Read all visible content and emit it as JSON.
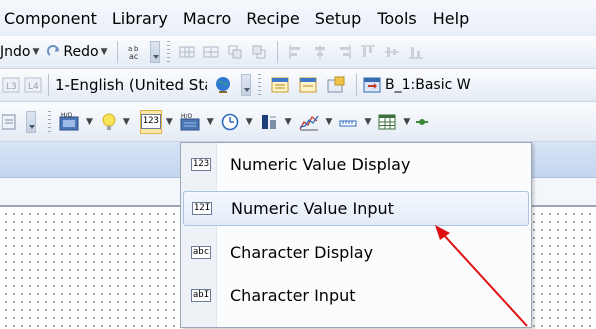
{
  "menubar": {
    "items": [
      "Component",
      "Library",
      "Macro",
      "Recipe",
      "Setup",
      "Tools",
      "Help"
    ]
  },
  "toolbar1": {
    "undo_label": "Jndo",
    "redo_label": "Redo"
  },
  "toolbar2": {
    "language_combo": "1-English (United Sta",
    "window_combo": "B_1:Basic W"
  },
  "toolbar3": {
    "numeric_button_icon": "numeric-123-icon"
  },
  "dropdown": {
    "items": [
      {
        "label": "Numeric Value Display",
        "icon": "123"
      },
      {
        "label": "Numeric Value Input",
        "icon": "12I"
      },
      {
        "label": "Character Display",
        "icon": "abc"
      },
      {
        "label": "Character Input",
        "icon": "abI"
      }
    ],
    "highlighted_index": 1
  },
  "colors": {
    "highlight_bg": "#e3ecf8",
    "selected_button": "#fde7a4",
    "annotation_arrow": "#e01010"
  }
}
